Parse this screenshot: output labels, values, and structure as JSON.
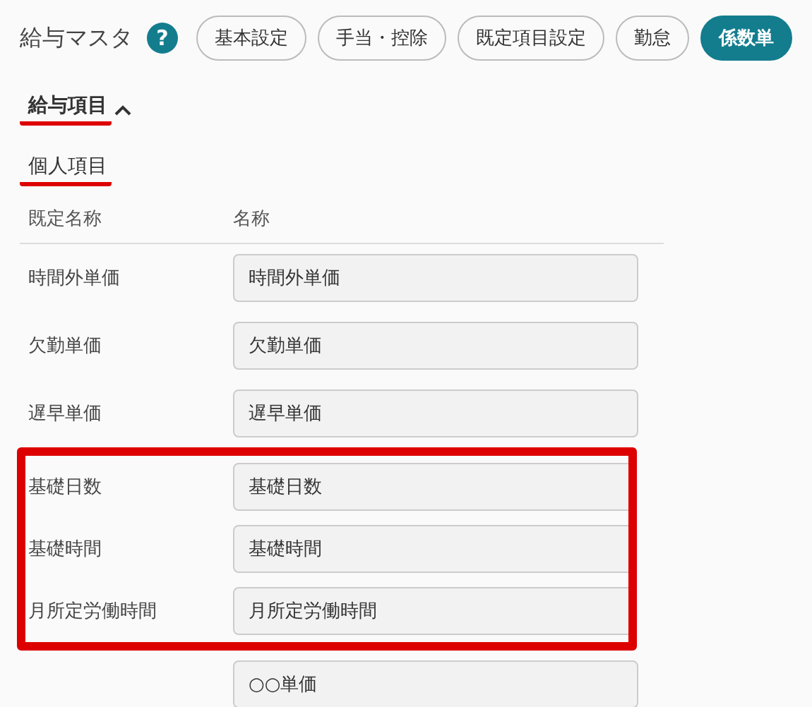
{
  "header": {
    "title": "給与マスタ",
    "help": "?"
  },
  "tabs": [
    {
      "label": "基本設定",
      "selected": false
    },
    {
      "label": "手当・控除",
      "selected": false
    },
    {
      "label": "既定項目設定",
      "selected": false
    },
    {
      "label": "勤怠",
      "selected": false
    },
    {
      "label": "係数単",
      "selected": true
    }
  ],
  "section": {
    "title": "給与項目",
    "expanded": true,
    "underlined": true
  },
  "subsection": {
    "title": "個人項目",
    "underlined": true
  },
  "table": {
    "columns": [
      "既定名称",
      "名称"
    ],
    "rows": [
      {
        "default_name": "時間外単価",
        "name": "時間外単価",
        "highlighted": false
      },
      {
        "default_name": "欠勤単価",
        "name": "欠勤単価",
        "highlighted": false
      },
      {
        "default_name": "遅早単価",
        "name": "遅早単価",
        "highlighted": false
      },
      {
        "default_name": "基礎日数",
        "name": "基礎日数",
        "highlighted": true
      },
      {
        "default_name": "基礎時間",
        "name": "基礎時間",
        "highlighted": true
      },
      {
        "default_name": "月所定労働時間",
        "name": "月所定労働時間",
        "highlighted": true
      },
      {
        "name": "○○単価",
        "highlighted": false
      }
    ]
  }
}
